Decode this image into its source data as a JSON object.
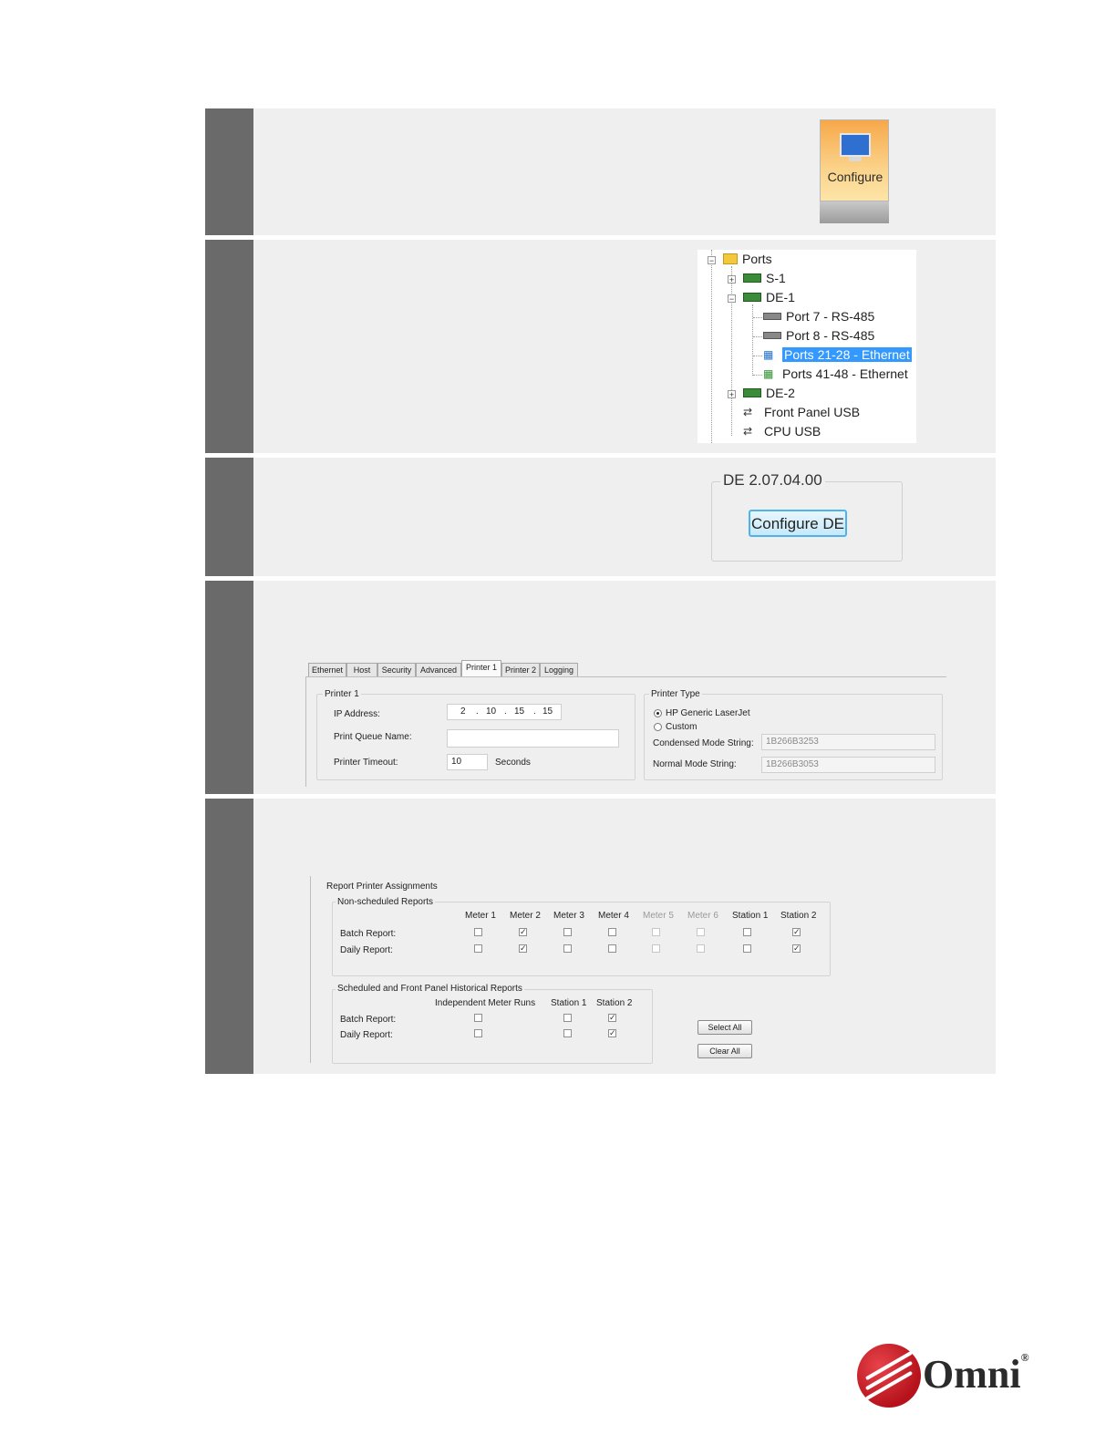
{
  "step1": {
    "button_label": "Configure",
    "icon": "monitor-icon"
  },
  "step2": {
    "tree": {
      "root": "Ports",
      "items": [
        "S-1",
        "DE-1",
        "Port 7 - RS-485",
        "Port 8 - RS-485",
        "Ports 21-28 - Ethernet",
        "Ports 41-48 - Ethernet",
        "DE-2",
        "Front Panel USB",
        "CPU USB"
      ],
      "selected": "Ports 21-28 - Ethernet"
    }
  },
  "step3": {
    "group_title": "DE 2.07.04.00",
    "button_label": "Configure DE"
  },
  "step4": {
    "tabs": [
      "Ethernet",
      "Host",
      "Security",
      "Advanced",
      "Printer 1",
      "Printer 2",
      "Logging"
    ],
    "active_tab": "Printer 1",
    "printer_group": "Printer 1",
    "ip_label": "IP Address:",
    "ip": [
      "2",
      "10",
      "15",
      "15"
    ],
    "ip_dot": ".",
    "queue_label": "Print Queue Name:",
    "queue_value": "",
    "timeout_label": "Printer Timeout:",
    "timeout_value": "10",
    "timeout_unit": "Seconds",
    "type_group": "Printer Type",
    "type_options": [
      "HP Generic LaserJet",
      "Custom"
    ],
    "type_selected": "HP Generic LaserJet",
    "condensed_label": "Condensed Mode String:",
    "condensed_value": "1B266B3253",
    "normal_label": "Normal Mode String:",
    "normal_value": "1B266B3053"
  },
  "step5": {
    "group_title": "Report Printer Assignments",
    "nonscheduled": {
      "title": "Non-scheduled Reports",
      "columns": [
        "Meter 1",
        "Meter 2",
        "Meter 3",
        "Meter 4",
        "Meter 5",
        "Meter 6",
        "Station 1",
        "Station 2"
      ],
      "disabled_columns": [
        "Meter 5",
        "Meter 6"
      ],
      "rows": [
        {
          "label": "Batch Report:",
          "checked": [
            false,
            true,
            false,
            false,
            false,
            false,
            false,
            true
          ]
        },
        {
          "label": "Daily Report:",
          "checked": [
            false,
            true,
            false,
            false,
            false,
            false,
            false,
            true
          ]
        }
      ]
    },
    "scheduled": {
      "title": "Scheduled and Front Panel Historical Reports",
      "columns": [
        "Independent Meter Runs",
        "Station 1",
        "Station 2"
      ],
      "rows": [
        {
          "label": "Batch Report:",
          "checked": [
            false,
            false,
            true
          ]
        },
        {
          "label": "Daily Report:",
          "checked": [
            false,
            false,
            true
          ]
        }
      ]
    },
    "select_all": "Select All",
    "clear_all": "Clear All"
  },
  "logo": {
    "text": "Omni",
    "reg": "®"
  },
  "colors": {
    "gutter": "#6b6a6b",
    "panel": "#efefef",
    "selection": "#3399ff",
    "brand_red": "#c8161e"
  }
}
